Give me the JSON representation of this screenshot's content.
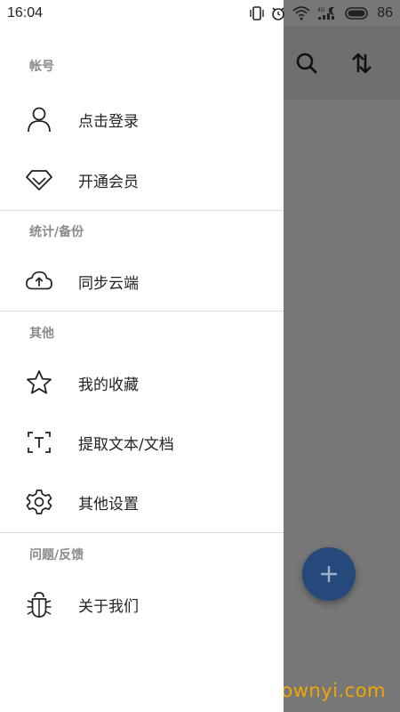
{
  "status_bar": {
    "time": "16:04",
    "battery": "86",
    "network_label": "4G"
  },
  "drawer": {
    "sections": [
      {
        "title": "帐号",
        "items": [
          {
            "label": "点击登录",
            "icon": "user-icon"
          },
          {
            "label": "开通会员",
            "icon": "diamond-icon"
          }
        ]
      },
      {
        "title": "统计/备份",
        "items": [
          {
            "label": "同步云端",
            "icon": "cloud-upload-icon"
          }
        ]
      },
      {
        "title": "其他",
        "items": [
          {
            "label": "我的收藏",
            "icon": "star-icon"
          },
          {
            "label": "提取文本/文档",
            "icon": "text-scan-icon"
          },
          {
            "label": "其他设置",
            "icon": "settings-icon"
          }
        ]
      },
      {
        "title": "问题/反馈",
        "items": [
          {
            "label": "关于我们",
            "icon": "bug-icon"
          }
        ]
      }
    ]
  },
  "background_app": {
    "fab_icon": "plus-icon",
    "toolbar_icons": [
      "search-icon",
      "sort-icon"
    ]
  },
  "watermark": "Downyi.com",
  "colors": {
    "fab": "#26497c",
    "scrim": "#777777",
    "watermark": "#f0a800"
  }
}
